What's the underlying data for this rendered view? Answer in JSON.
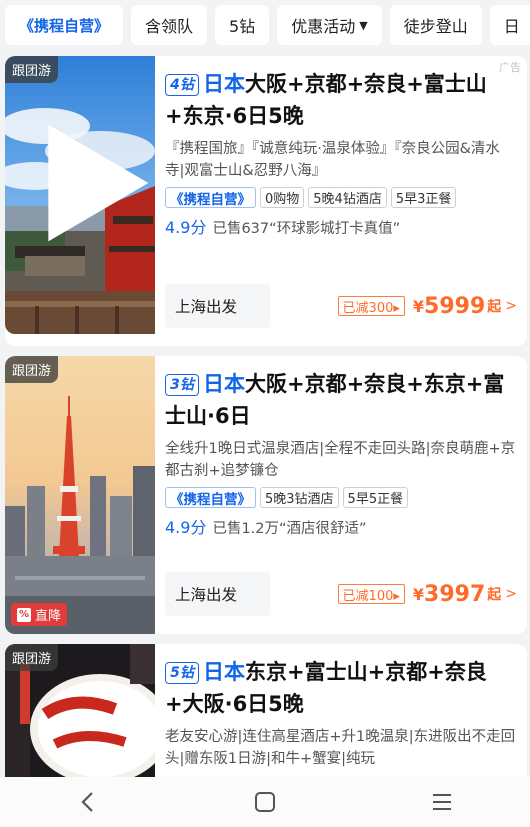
{
  "filters": {
    "brand": "《携程自营》",
    "items": [
      "含领队",
      "5钻",
      "优惠活动",
      "徒步登山",
      "日"
    ]
  },
  "ad_label": "广告",
  "products": [
    {
      "group_tag": "跟团游",
      "diamond": "4钻",
      "title_blue": "日本",
      "title_rest": "大阪+京都+奈良+富士山+东京·6日5晚",
      "desc": "『携程国旅』『诚意纯玩·温泉体验』『奈良公园&清水寺|观富士山&忍野八海』",
      "badge_brand": "《携程自营》",
      "badges": [
        "0购物",
        "5晚4钻酒店",
        "5早3正餐"
      ],
      "score": "4.9分",
      "sold": "已售637“环球影城打卡真值”",
      "depart": "上海出发",
      "discount": "已减300▸",
      "currency": "¥",
      "price": "5999",
      "price_suffix": "起"
    },
    {
      "group_tag": "跟团游",
      "diamond": "3钻",
      "title_blue": "日本",
      "title_rest": "大阪+京都+奈良+东京+富士山·6日",
      "desc": "全线升1晚日式温泉酒店|全程不走回头路|奈良萌鹿+京都古刹+追梦镰仓",
      "badge_brand": "《携程自营》",
      "badges": [
        "5晚3钻酒店",
        "5早5正餐"
      ],
      "score": "4.9分",
      "sold": "已售1.2万“酒店很舒适”",
      "depart": "上海出发",
      "discount": "已减100▸",
      "currency": "¥",
      "price": "3997",
      "price_suffix": "起",
      "price_drop": "直降"
    },
    {
      "group_tag": "跟团游",
      "diamond": "5钻",
      "title_blue": "日本",
      "title_rest": "东京+富士山+京都+奈良+大阪·6日5晚",
      "desc": "老友安心游|连住高星酒店+升1晚温泉|东进阪出不走回头|赠东阪1日游|和牛+蟹宴|纯玩"
    }
  ],
  "nav": {
    "back": "back-icon",
    "home": "home-icon",
    "menu": "menu-icon"
  }
}
